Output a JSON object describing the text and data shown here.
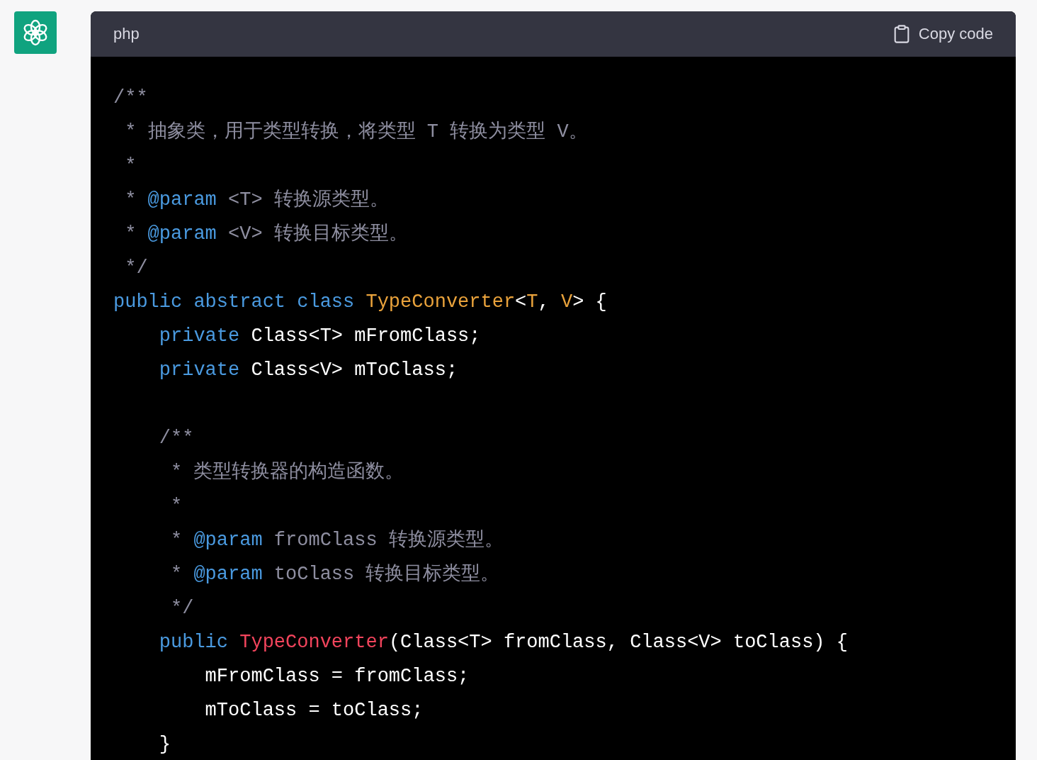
{
  "code_block": {
    "language": "php",
    "copy_label": "Copy code",
    "lines": [
      {
        "kind": "code",
        "tokens": [
          {
            "kind": "comment",
            "text": "/**"
          }
        ]
      },
      {
        "kind": "code",
        "tokens": [
          {
            "kind": "comment",
            "text": " * 抽象类，用于类型转换，将类型 T 转换为类型 V。"
          }
        ]
      },
      {
        "kind": "code",
        "tokens": [
          {
            "kind": "comment",
            "text": " *"
          }
        ]
      },
      {
        "kind": "code",
        "tokens": [
          {
            "kind": "comment",
            "text": " * "
          },
          {
            "kind": "doctag",
            "text": "@param"
          },
          {
            "kind": "comment",
            "text": " <T> 转换源类型。"
          }
        ]
      },
      {
        "kind": "code",
        "tokens": [
          {
            "kind": "comment",
            "text": " * "
          },
          {
            "kind": "doctag",
            "text": "@param"
          },
          {
            "kind": "comment",
            "text": " <V> 转换目标类型。"
          }
        ]
      },
      {
        "kind": "code",
        "tokens": [
          {
            "kind": "comment",
            "text": " */"
          }
        ]
      },
      {
        "kind": "code",
        "tokens": [
          {
            "kind": "keyword",
            "text": "public abstract class "
          },
          {
            "kind": "type",
            "text": "TypeConverter"
          },
          {
            "kind": "plain",
            "text": "<"
          },
          {
            "kind": "type",
            "text": "T"
          },
          {
            "kind": "plain",
            "text": ", "
          },
          {
            "kind": "type",
            "text": "V"
          },
          {
            "kind": "plain",
            "text": "> {"
          }
        ]
      },
      {
        "kind": "code",
        "tokens": [
          {
            "kind": "keyword",
            "text": "    private"
          },
          {
            "kind": "plain",
            "text": " Class<T> mFromClass;"
          }
        ]
      },
      {
        "kind": "code",
        "tokens": [
          {
            "kind": "keyword",
            "text": "    private"
          },
          {
            "kind": "plain",
            "text": " Class<V> mToClass;"
          }
        ]
      },
      {
        "kind": "blank"
      },
      {
        "kind": "code",
        "tokens": [
          {
            "kind": "comment",
            "text": "    /**"
          }
        ]
      },
      {
        "kind": "code",
        "tokens": [
          {
            "kind": "comment",
            "text": "     * 类型转换器的构造函数。"
          }
        ]
      },
      {
        "kind": "code",
        "tokens": [
          {
            "kind": "comment",
            "text": "     *"
          }
        ]
      },
      {
        "kind": "code",
        "tokens": [
          {
            "kind": "comment",
            "text": "     * "
          },
          {
            "kind": "doctag",
            "text": "@param"
          },
          {
            "kind": "comment",
            "text": " fromClass 转换源类型。"
          }
        ]
      },
      {
        "kind": "code",
        "tokens": [
          {
            "kind": "comment",
            "text": "     * "
          },
          {
            "kind": "doctag",
            "text": "@param"
          },
          {
            "kind": "comment",
            "text": " toClass 转换目标类型。"
          }
        ]
      },
      {
        "kind": "code",
        "tokens": [
          {
            "kind": "comment",
            "text": "     */"
          }
        ]
      },
      {
        "kind": "code",
        "tokens": [
          {
            "kind": "keyword",
            "text": "    public "
          },
          {
            "kind": "function",
            "text": "TypeConverter"
          },
          {
            "kind": "plain",
            "text": "(Class<T> fromClass, Class<V> toClass) {"
          }
        ]
      },
      {
        "kind": "code",
        "tokens": [
          {
            "kind": "plain",
            "text": "        mFromClass = fromClass;"
          }
        ]
      },
      {
        "kind": "code",
        "tokens": [
          {
            "kind": "plain",
            "text": "        mToClass = toClass;"
          }
        ]
      },
      {
        "kind": "code",
        "tokens": [
          {
            "kind": "plain",
            "text": "    }"
          }
        ]
      }
    ]
  }
}
